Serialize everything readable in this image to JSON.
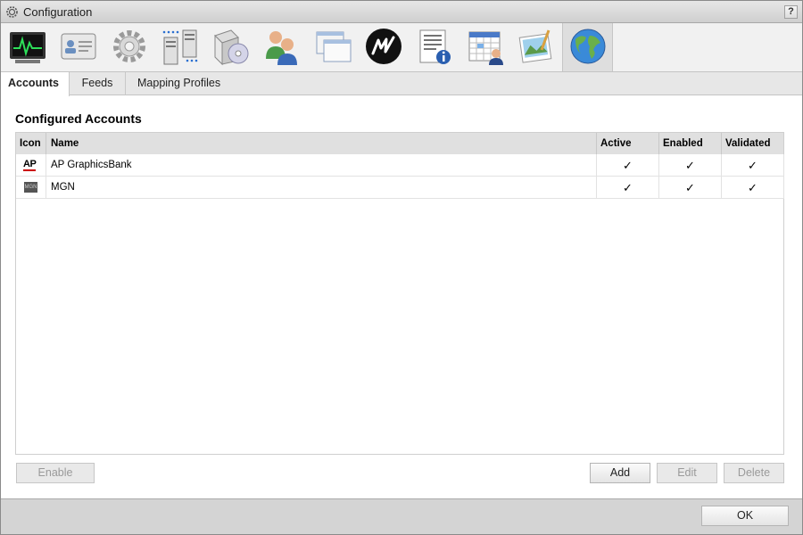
{
  "window": {
    "title": "Configuration",
    "help_label": "?"
  },
  "toolbar": {
    "items": [
      {
        "name": "monitor",
        "icon": "monitor-icon"
      },
      {
        "name": "id-card",
        "icon": "id-card-icon"
      },
      {
        "name": "settings",
        "icon": "gear-icon"
      },
      {
        "name": "servers",
        "icon": "server-icon"
      },
      {
        "name": "software",
        "icon": "software-box-icon"
      },
      {
        "name": "users",
        "icon": "users-icon"
      },
      {
        "name": "windows",
        "icon": "windows-icon"
      },
      {
        "name": "m-logo",
        "icon": "m-logo-icon"
      },
      {
        "name": "info",
        "icon": "document-info-icon"
      },
      {
        "name": "schedule",
        "icon": "calendar-user-icon"
      },
      {
        "name": "graphics",
        "icon": "picture-icon"
      },
      {
        "name": "globe",
        "icon": "globe-icon",
        "selected": true
      }
    ]
  },
  "tabs": [
    {
      "label": "Accounts",
      "active": true
    },
    {
      "label": "Feeds"
    },
    {
      "label": "Mapping Profiles"
    }
  ],
  "main": {
    "section_title": "Configured Accounts",
    "columns": {
      "icon": "Icon",
      "name": "Name",
      "active": "Active",
      "enabled": "Enabled",
      "validated": "Validated"
    },
    "rows": [
      {
        "icon": "ap-logo",
        "logo_text": "AP",
        "name": "AP GraphicsBank",
        "active": "✓",
        "enabled": "✓",
        "validated": "✓"
      },
      {
        "icon": "mgn-logo",
        "logo_text": "MGN",
        "name": "MGN",
        "active": "✓",
        "enabled": "✓",
        "validated": "✓"
      }
    ]
  },
  "buttons": {
    "enable": "Enable",
    "add": "Add",
    "edit": "Edit",
    "delete": "Delete",
    "ok": "OK"
  },
  "colors": {
    "header_bg": "#e0e0e0",
    "footer_bg": "#d4d4d4",
    "toolbar_bg": "#f1f1f1"
  }
}
